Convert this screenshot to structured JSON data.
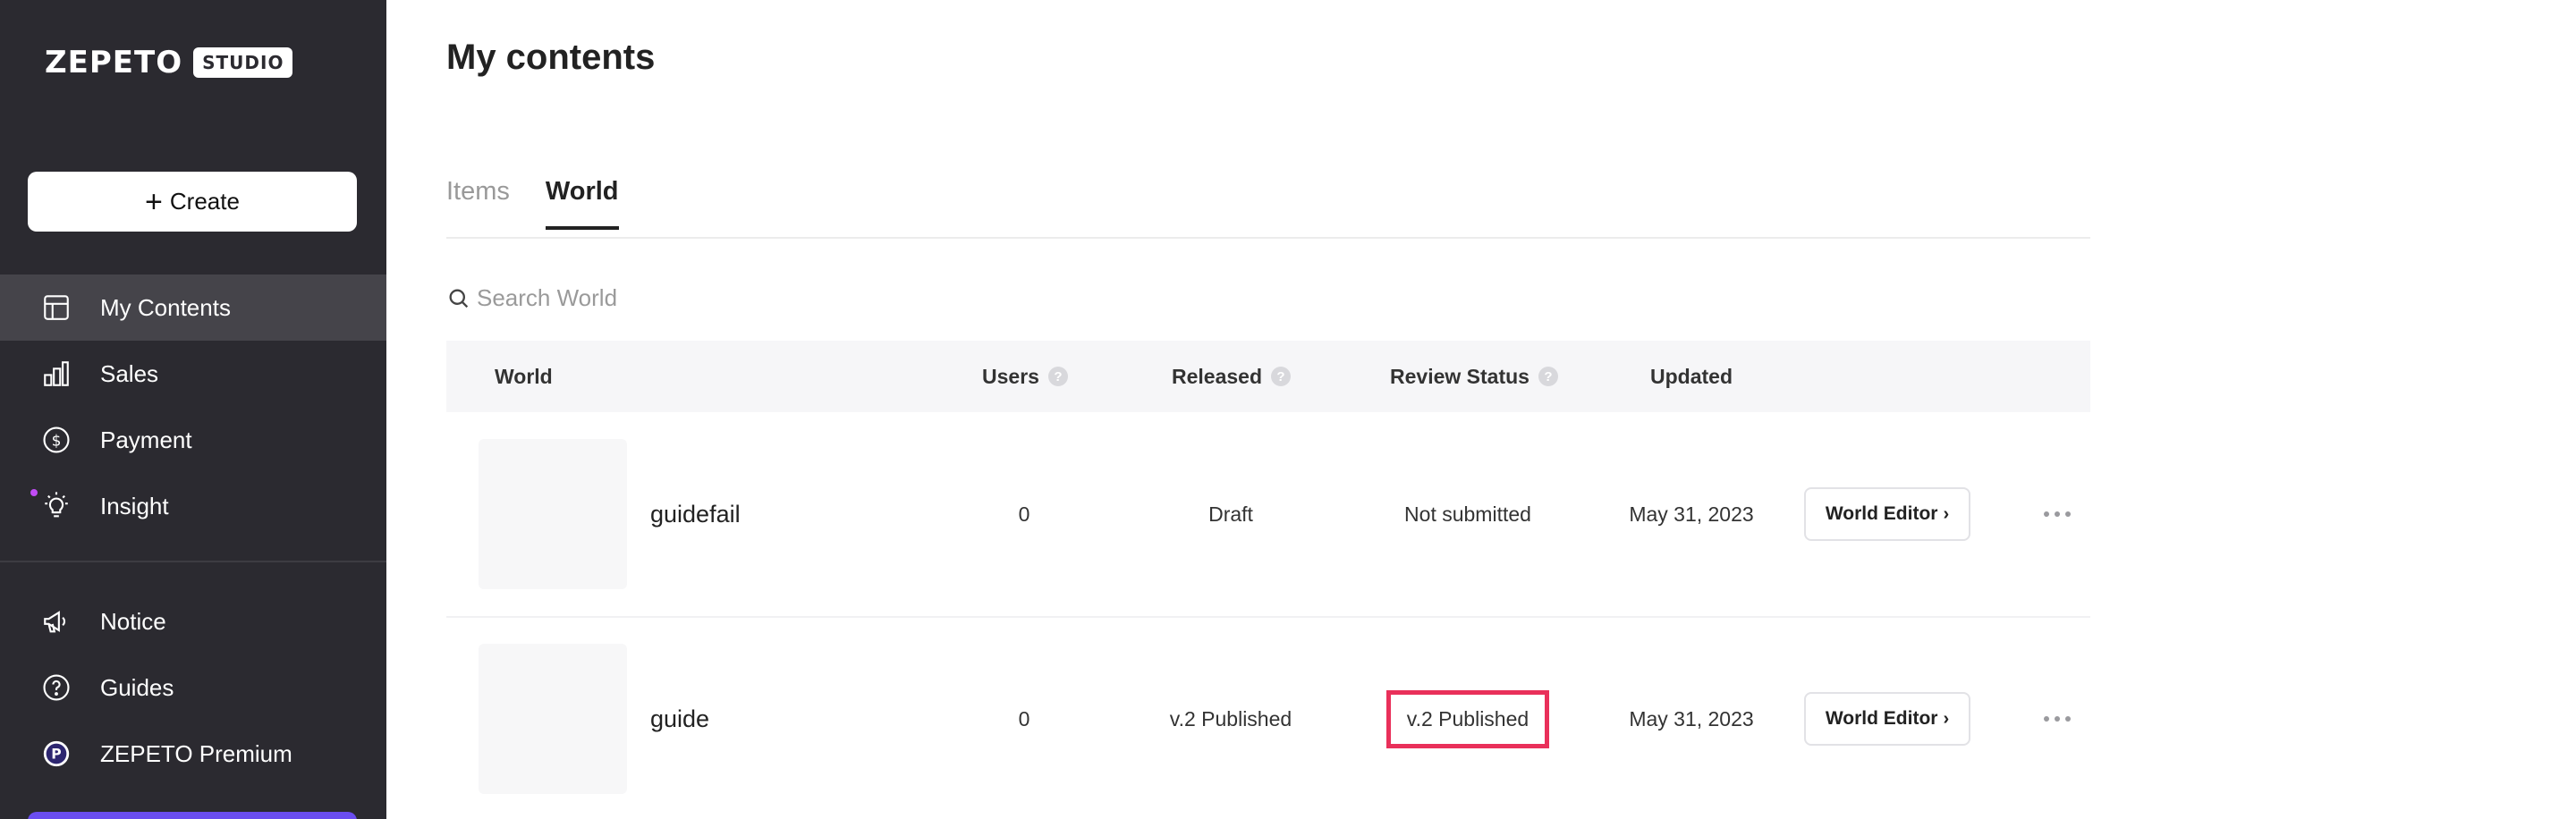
{
  "brand": {
    "logo": "ZEPETO",
    "badge": "STUDIO"
  },
  "sidebar": {
    "create_label": "Create",
    "items": [
      {
        "label": "My Contents",
        "icon": "layout-icon",
        "active": true
      },
      {
        "label": "Sales",
        "icon": "bar-chart-icon"
      },
      {
        "label": "Payment",
        "icon": "dollar-circle-icon"
      },
      {
        "label": "Insight",
        "icon": "lightbulb-icon",
        "dot": true
      }
    ],
    "secondary": [
      {
        "label": "Notice",
        "icon": "megaphone-icon"
      },
      {
        "label": "Guides",
        "icon": "question-circle-icon"
      },
      {
        "label": "ZEPETO Premium",
        "icon": "premium-p-icon"
      }
    ],
    "colors": {
      "bg": "#2b2a30",
      "active": "#45444a",
      "dot": "#c14cf5"
    }
  },
  "main": {
    "title": "My contents",
    "tabs": [
      {
        "label": "Items",
        "active": false
      },
      {
        "label": "World",
        "active": true
      }
    ],
    "search": {
      "placeholder": "Search World",
      "value": ""
    },
    "table": {
      "headers": {
        "world": "World",
        "users": "Users",
        "released": "Released",
        "review": "Review Status",
        "updated": "Updated"
      },
      "rows": [
        {
          "name": "guidefail",
          "users": "0",
          "released": "Draft",
          "review": "Not submitted",
          "updated": "May 31, 2023",
          "action": "World Editor"
        },
        {
          "name": "guide",
          "users": "0",
          "released": "v.2 Published",
          "review": "v.2 Published",
          "updated": "May 31, 2023",
          "action": "World Editor"
        }
      ]
    },
    "highlight_color": "#e9305a"
  }
}
